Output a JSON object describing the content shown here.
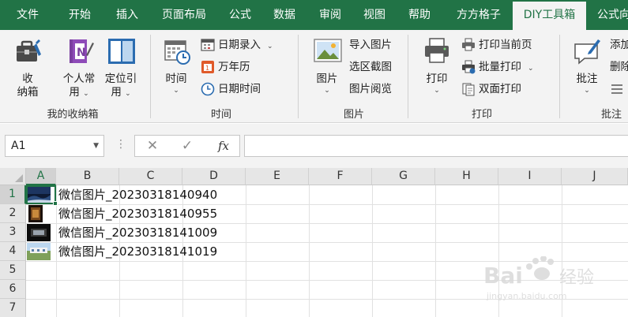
{
  "tabs": [
    {
      "label": "文件"
    },
    {
      "label": "开始"
    },
    {
      "label": "插入"
    },
    {
      "label": "页面布局"
    },
    {
      "label": "公式"
    },
    {
      "label": "数据"
    },
    {
      "label": "审阅"
    },
    {
      "label": "视图"
    },
    {
      "label": "帮助"
    },
    {
      "label": "方方格子"
    },
    {
      "label": "DIY工具箱"
    },
    {
      "label": "公式向"
    }
  ],
  "ribbon": {
    "group_storage": {
      "label": "我的收纳箱",
      "btn_storage": {
        "line1": "收",
        "line2": "纳箱"
      },
      "btn_personal": {
        "line1": "个人常",
        "line2": "用"
      },
      "btn_locate": {
        "line1": "定位引",
        "line2": "用"
      }
    },
    "group_time": {
      "label": "时间",
      "btn_time": {
        "label": "时间"
      },
      "date_entry": "日期录入",
      "calendar": "万年历",
      "datetime": "日期时间"
    },
    "group_image": {
      "label": "图片",
      "btn_image": {
        "label": "图片"
      },
      "import": "导入图片",
      "capture": "选区截图",
      "browse": "图片阅览"
    },
    "group_print": {
      "label": "打印",
      "btn_print": {
        "label": "打印"
      },
      "print_current": "打印当前页",
      "batch_print": "批量打印",
      "duplex_print": "双面打印"
    },
    "group_comment": {
      "label": "批注",
      "btn_comment": {
        "label": "批注"
      },
      "add": "添加",
      "delete": "删除"
    }
  },
  "formula_bar": {
    "name_box": "A1",
    "cancel": "✕",
    "confirm": "✓",
    "fx": "fx",
    "value": ""
  },
  "grid": {
    "columns": [
      "A",
      "B",
      "C",
      "D",
      "E",
      "F",
      "G",
      "H",
      "I",
      "J"
    ],
    "rows": [
      "1",
      "2",
      "3",
      "4",
      "5",
      "6",
      "7"
    ],
    "cells": [
      {
        "text": "微信图片_20230318140940"
      },
      {
        "text": "微信图片_20230318140955"
      },
      {
        "text": "微信图片_20230318141009"
      },
      {
        "text": "微信图片_20230318141019"
      }
    ]
  },
  "colors": {
    "brand": "#217346",
    "ribbon_bg": "#f3f3f3",
    "header_bg": "#e6e6e6"
  }
}
